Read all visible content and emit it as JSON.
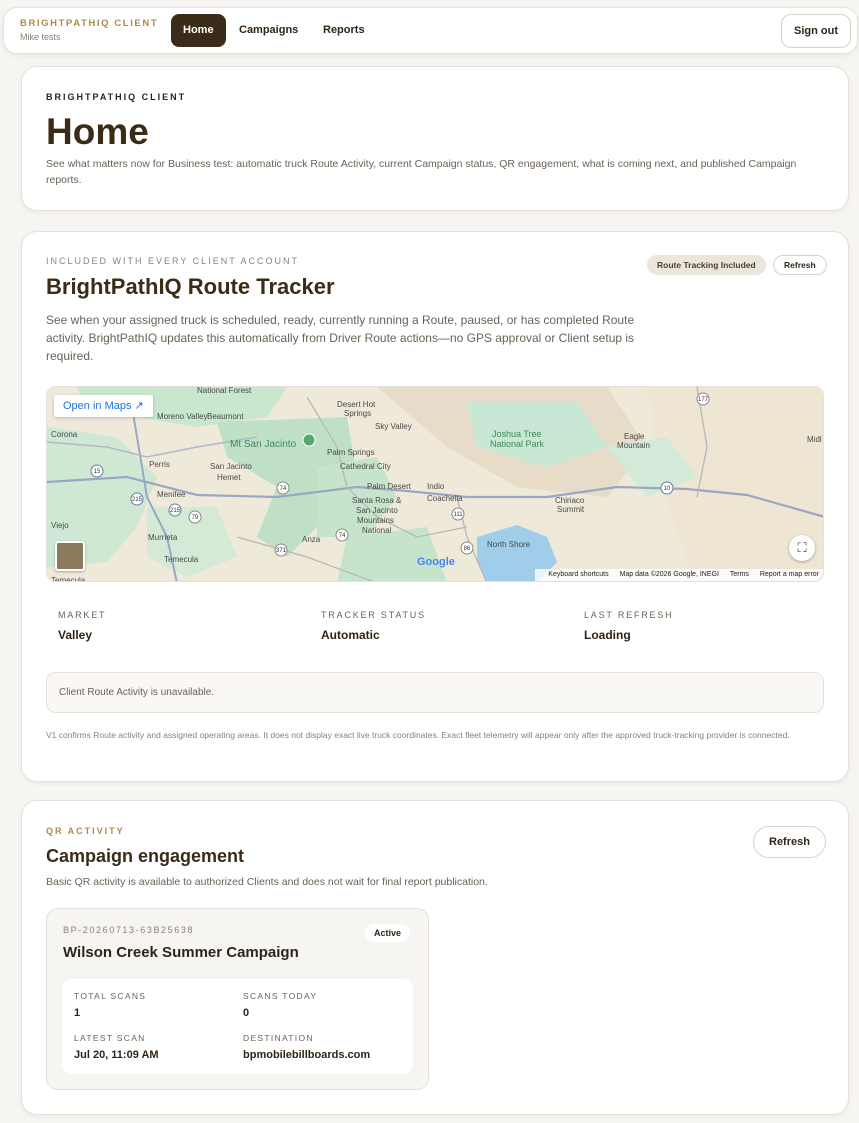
{
  "header": {
    "brand": "BRIGHTPATHIQ CLIENT",
    "user": "Mike tests",
    "nav": [
      "Home",
      "Campaigns",
      "Reports"
    ],
    "sign_out": "Sign out"
  },
  "home": {
    "eyebrow": "BRIGHTPATHIQ CLIENT",
    "title": "Home",
    "description": "See what matters now for Business test: automatic truck Route Activity, current Campaign status, QR engagement, what is coming next, and published Campaign reports."
  },
  "route": {
    "eyebrow": "INCLUDED WITH EVERY CLIENT ACCOUNT",
    "title": "BrightPathIQ Route Tracker",
    "description": "See when your assigned truck is scheduled, ready, currently running a Route, paused, or has completed Route activity. BrightPathIQ updates this automatically from Driver Route actions—no GPS approval or Client setup is required.",
    "badge": "Route Tracking Included",
    "refresh": "Refresh",
    "map": {
      "open_maps": "Open in Maps",
      "google": "Google",
      "footer": [
        "Keyboard shortcuts",
        "Map data ©2026 Google, INEGI",
        "Terms",
        "Report a map error"
      ],
      "places": [
        "National Forest",
        "Desert Hot Springs",
        "Moreno Valley",
        "Beaumont",
        "Sky Valley",
        "Joshua Tree National Park",
        "Eagle Mountain",
        "Midl",
        "Corona",
        "Mt San Jacinto",
        "Palm Springs",
        "Cathedral City",
        "Perris",
        "San Jacinto",
        "Hemet",
        "Menifee",
        "Palm Desert",
        "Indio",
        "Santa Rosa & San Jacinto Mountains National",
        "Coachella",
        "Chiriaco Summit",
        "Viejo",
        "Murrieta",
        "Temecula",
        "Anza",
        "North Shore",
        "Temecula"
      ],
      "highways": [
        "15",
        "215",
        "74",
        "79",
        "371",
        "74",
        "111",
        "86",
        "10",
        "177",
        "10",
        "79"
      ]
    },
    "stats": [
      {
        "label": "MARKET",
        "value": "Valley"
      },
      {
        "label": "TRACKER STATUS",
        "value": "Automatic"
      },
      {
        "label": "LAST REFRESH",
        "value": "Loading"
      }
    ],
    "notice": "Client Route Activity is unavailable.",
    "footnote": "V1 confirms Route activity and assigned operating areas. It does not display exact live truck coordinates. Exact fleet telemetry will appear only after the approved truck-tracking provider is connected."
  },
  "qr": {
    "eyebrow": "QR ACTIVITY",
    "title": "Campaign engagement",
    "description": "Basic QR activity is available to authorized Clients and does not wait for final report publication.",
    "refresh": "Refresh",
    "campaign": {
      "id": "BP-20260713-63B25638",
      "name": "Wilson Creek Summer Campaign",
      "status": "Active",
      "metrics": [
        {
          "label": "TOTAL SCANS",
          "value": "1"
        },
        {
          "label": "SCANS TODAY",
          "value": "0"
        },
        {
          "label": "LATEST SCAN",
          "value": "Jul 20, 11:09 AM"
        },
        {
          "label": "DESTINATION",
          "value": "bpmobilebillboards.com"
        }
      ]
    }
  }
}
